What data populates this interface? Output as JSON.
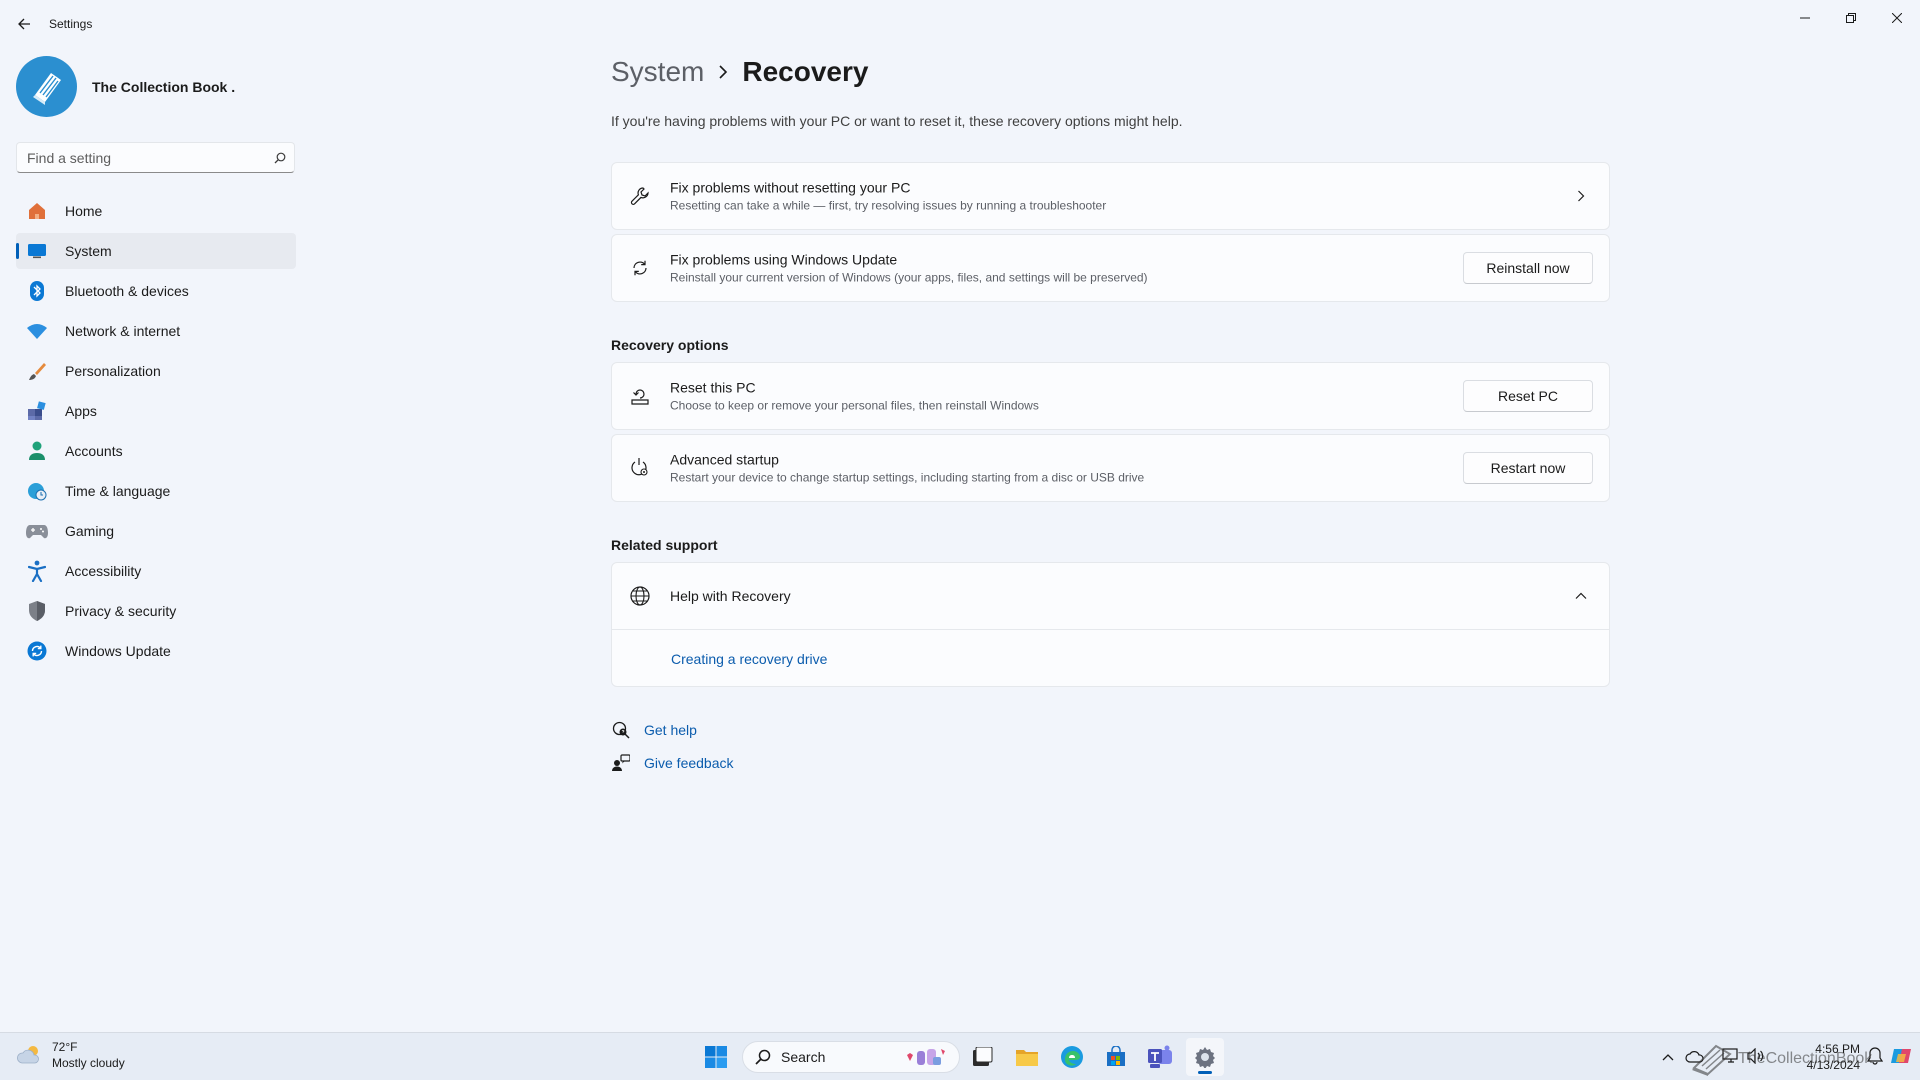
{
  "window": {
    "title": "Settings"
  },
  "profile": {
    "name": "The Collection Book ."
  },
  "search": {
    "placeholder": "Find a setting"
  },
  "sidebar": {
    "items": [
      {
        "label": "Home",
        "icon": "home-icon"
      },
      {
        "label": "System",
        "icon": "system-icon",
        "active": true
      },
      {
        "label": "Bluetooth & devices",
        "icon": "bluetooth-icon"
      },
      {
        "label": "Network & internet",
        "icon": "wifi-icon"
      },
      {
        "label": "Personalization",
        "icon": "brush-icon"
      },
      {
        "label": "Apps",
        "icon": "apps-icon"
      },
      {
        "label": "Accounts",
        "icon": "person-icon"
      },
      {
        "label": "Time & language",
        "icon": "globe-clock-icon"
      },
      {
        "label": "Gaming",
        "icon": "gamepad-icon"
      },
      {
        "label": "Accessibility",
        "icon": "accessibility-icon"
      },
      {
        "label": "Privacy & security",
        "icon": "shield-icon"
      },
      {
        "label": "Windows Update",
        "icon": "update-icon"
      }
    ]
  },
  "breadcrumb": {
    "parent": "System",
    "current": "Recovery"
  },
  "page": {
    "description": "If you're having problems with your PC or want to reset it, these recovery options might help."
  },
  "cards": {
    "fix_no_reset": {
      "title": "Fix problems without resetting your PC",
      "subtitle": "Resetting can take a while — first, try resolving issues by running a troubleshooter"
    },
    "fix_update": {
      "title": "Fix problems using Windows Update",
      "subtitle": "Reinstall your current version of Windows (your apps, files, and settings will be preserved)",
      "button": "Reinstall now"
    },
    "reset_pc": {
      "title": "Reset this PC",
      "subtitle": "Choose to keep or remove your personal files, then reinstall Windows",
      "button": "Reset PC"
    },
    "advanced_startup": {
      "title": "Advanced startup",
      "subtitle": "Restart your device to change startup settings, including starting from a disc or USB drive",
      "button": "Restart now"
    }
  },
  "sections": {
    "recovery_options": "Recovery options",
    "related_support": "Related support"
  },
  "help_recovery": {
    "title": "Help with Recovery",
    "link": "Creating a recovery drive"
  },
  "links": {
    "get_help": "Get help",
    "give_feedback": "Give feedback"
  },
  "taskbar": {
    "weather_temp": "72°F",
    "weather_desc": "Mostly cloudy",
    "search_label": "Search",
    "time": "4:56 PM",
    "date": "4/13/2024"
  },
  "watermark": {
    "text": "TheCollectionBook"
  },
  "colors": {
    "accent": "#005fb8",
    "link": "#0b5cad",
    "background": "#f2f5fb"
  }
}
